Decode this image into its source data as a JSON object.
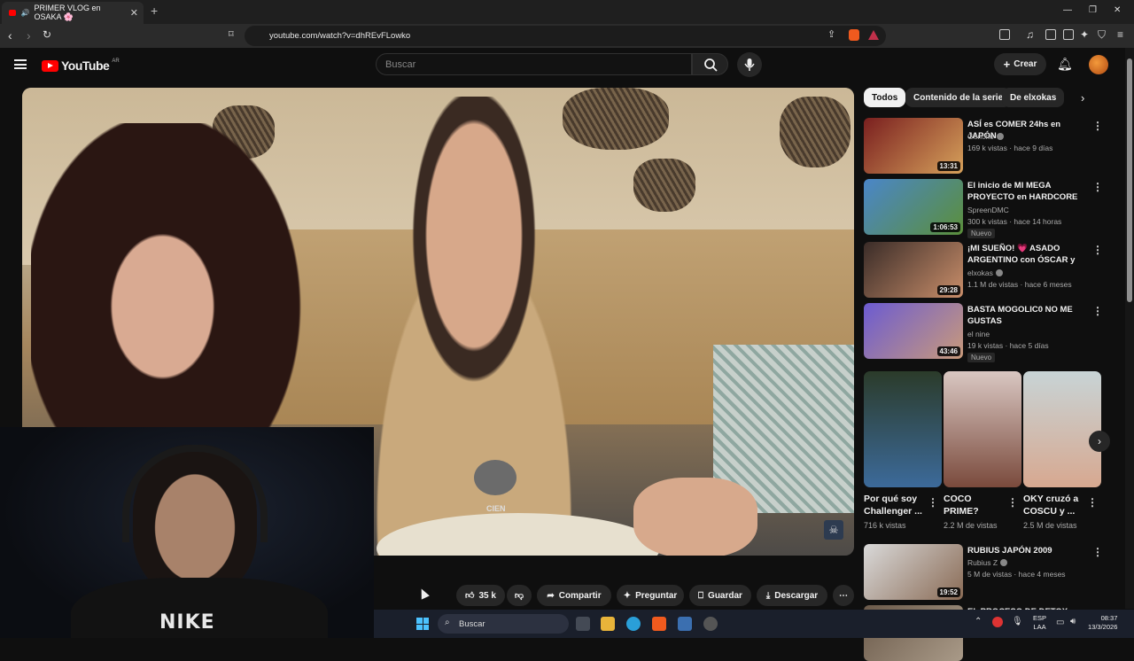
{
  "browser": {
    "tab_title": "PRIMER VLOG en OSAKA 🌸",
    "tab_close": "✕",
    "new_tab": "+",
    "url": "youtube.com/watch?v=dhREvFLowko",
    "window_controls": [
      "—",
      "❐",
      "✕"
    ]
  },
  "header": {
    "logo_text": "YouTube",
    "logo_region": "AR",
    "search_placeholder": "Buscar",
    "create_label": "Crear"
  },
  "actions": {
    "likes": "35 k",
    "share": "Compartir",
    "ask": "Preguntar",
    "save": "Guardar",
    "download": "Descargar"
  },
  "video": {
    "mic_text": "CIEN",
    "corner_logo": "☠",
    "webcam_shirt_text": "NIKE"
  },
  "chips": [
    "Todos",
    "Contenido de la serie",
    "De elxokas"
  ],
  "recommendations": [
    {
      "title": "ASÍ es COMER 24hs en JAPÓN",
      "channel": "Goncho",
      "verified": true,
      "meta": "169 k vistas · hace 9 días",
      "duration": "13:31",
      "badge": "",
      "thumb_colors": [
        "#7a1f1f",
        "#d6a15b"
      ]
    },
    {
      "title": "El inicio de MI MEGA PROYECTO en HARDCORE",
      "channel": "SpreenDMC",
      "verified": false,
      "meta": "300 k vistas · hace 14 horas",
      "duration": "1:06:53",
      "badge": "Nuevo",
      "thumb_colors": [
        "#4a86c9",
        "#5b8f3a"
      ]
    },
    {
      "title": "¡MI SUEÑO! 💗 ASADO ARGENTINO con ÓSCAR y ...",
      "channel": "elxokas",
      "verified": true,
      "meta": "1.1 M de vistas · hace 6 meses",
      "duration": "29:28",
      "badge": "",
      "thumb_colors": [
        "#3a2c28",
        "#c98e6a"
      ]
    },
    {
      "title": "BASTA MOGOLIC0 NO ME GUSTAS",
      "channel": "el nine",
      "verified": false,
      "meta": "19 k vistas · hace 5 días",
      "duration": "43:46",
      "badge": "Nuevo",
      "thumb_colors": [
        "#6c5bd1",
        "#c99a7a"
      ]
    },
    {
      "title": "RUBIUS JAPÓN 2009",
      "channel": "Rubius Z",
      "verified": true,
      "meta": "5 M de vistas · hace 4 meses",
      "duration": "19:52",
      "badge": "",
      "thumb_colors": [
        "#d9d9d9",
        "#8a6b55"
      ]
    },
    {
      "title": "EL PROCESO DE DETOX DE",
      "channel": "",
      "verified": false,
      "meta": "",
      "duration": "",
      "badge": "",
      "thumb_colors": [
        "#6b5a4a",
        "#a99a88"
      ]
    }
  ],
  "shorts": [
    {
      "title": "Por qué soy Challenger ...",
      "views": "716 k vistas",
      "thumb_colors": [
        "#2b3b2a",
        "#3c6a9a"
      ]
    },
    {
      "title": "COCO PRIME?",
      "views": "2.2 M de vistas",
      "thumb_colors": [
        "#d9c7c2",
        "#7a4a3c"
      ]
    },
    {
      "title": "OKY cruzó a COSCU y ...",
      "views": "2.5 M de vistas",
      "thumb_colors": [
        "#c8d4d6",
        "#d7a890"
      ]
    }
  ],
  "taskbar": {
    "search_placeholder": "Buscar",
    "lang_line1": "ESP",
    "lang_line2": "LAA",
    "time": "08:37",
    "date": "13/3/2026"
  },
  "colors": {
    "accent": "#ff0000",
    "background": "#0f0f0f",
    "surface": "#272727"
  }
}
